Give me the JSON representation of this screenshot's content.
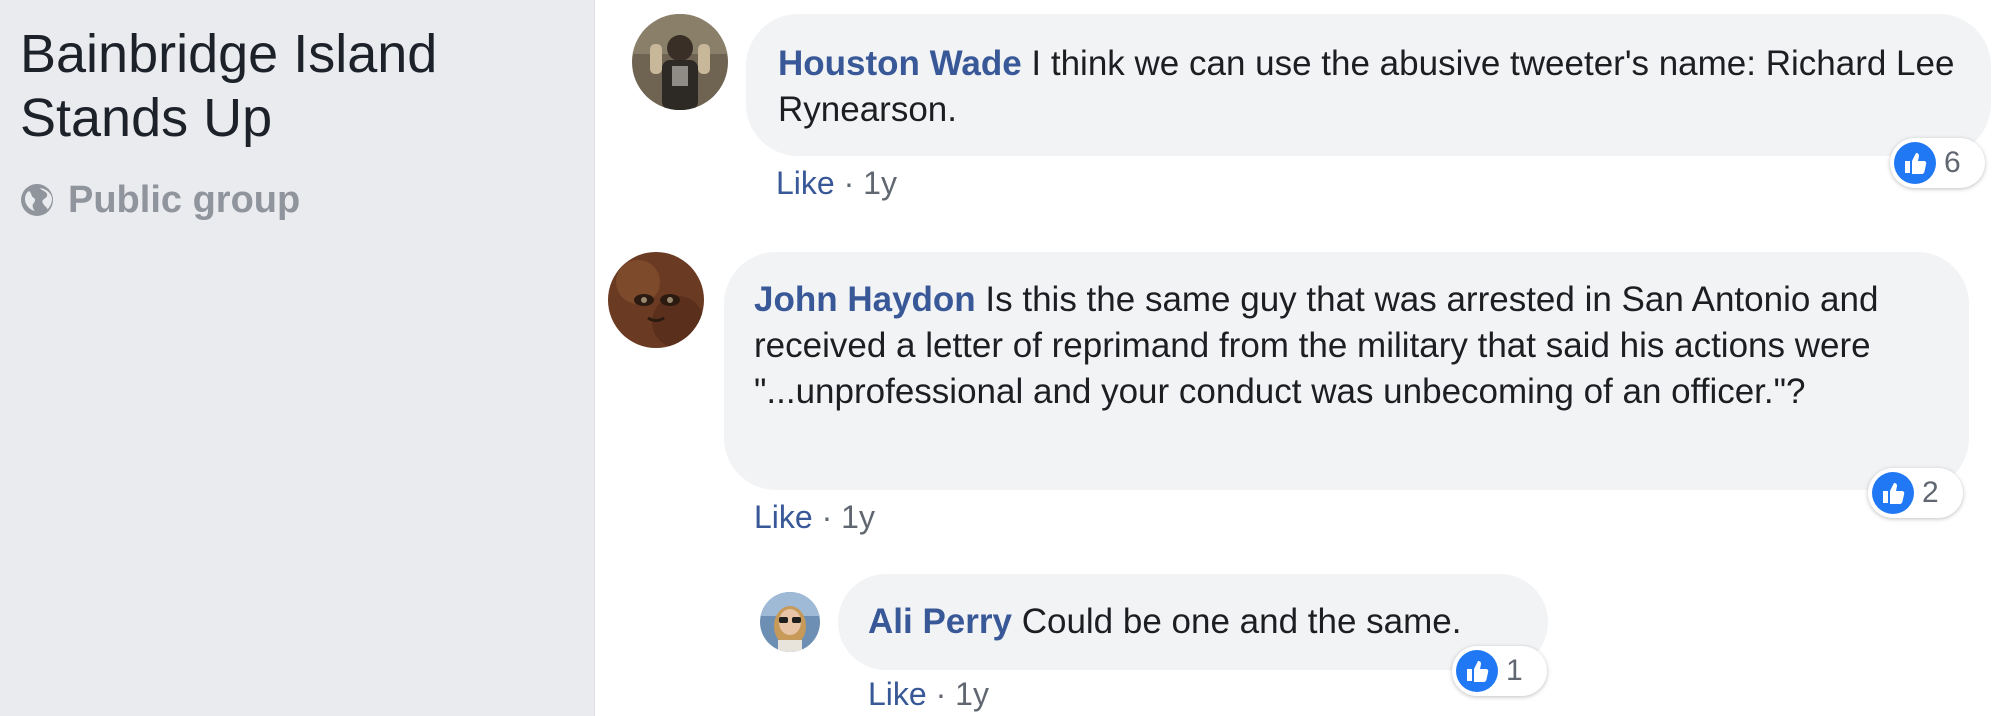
{
  "group": {
    "name": "Bainbridge Island Stands Up",
    "privacy": "Public group"
  },
  "comments": [
    {
      "author": "Houston Wade",
      "text": "I think we can use the abusive tweeter's name: Richard Lee Rynearson.",
      "like_label": "Like",
      "separator": "·",
      "time": "1y",
      "reaction_count": "6"
    },
    {
      "author": "John Haydon",
      "text": "Is this the same guy that was arrested in San Antonio and received a letter of reprimand from the military that said his actions were \"...unprofessional and your conduct was unbecoming of an officer.\"?",
      "like_label": "Like",
      "separator": "·",
      "time": "1y",
      "reaction_count": "2"
    },
    {
      "author": "Ali Perry",
      "text": "Could be one and the same.",
      "like_label": "Like",
      "separator": "·",
      "time": "1y",
      "reaction_count": "1"
    }
  ],
  "colors": {
    "author_link": "#385898",
    "like_badge": "#2078f4",
    "bubble": "#f2f3f5",
    "sidebar": "#e9ebee"
  },
  "icons": {
    "privacy": "globe-icon",
    "reaction": "thumbs-up-icon"
  }
}
